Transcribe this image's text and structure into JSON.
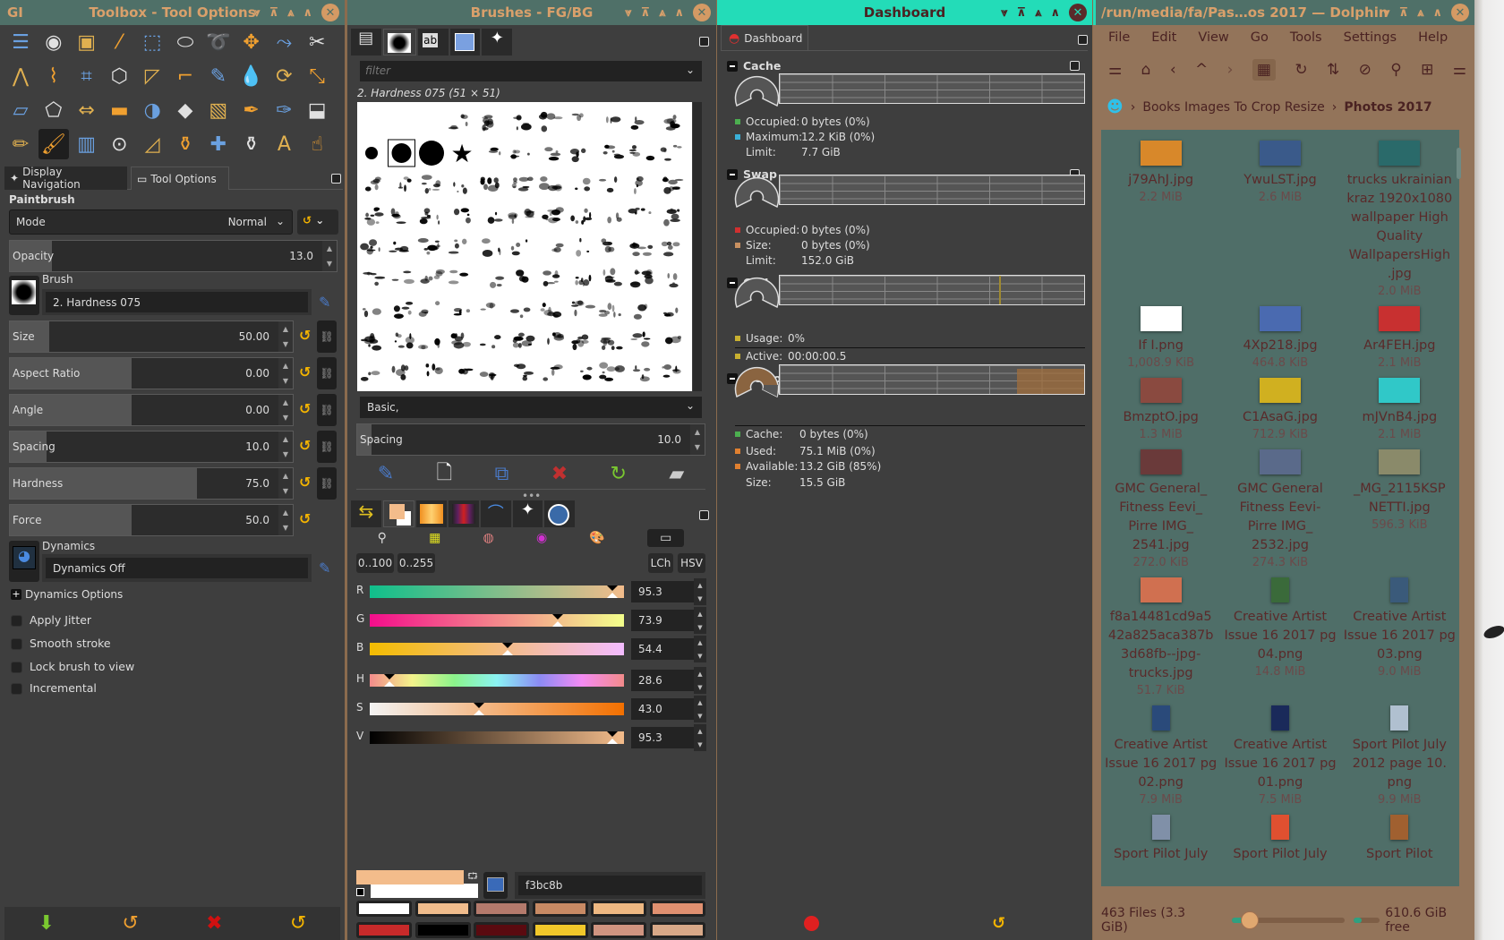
{
  "toolbox": {
    "app_icon": "GI",
    "title": "Toolbox - Tool Options",
    "tools": [
      "align-icon",
      "fg-select-icon",
      "foreground-select-icon",
      "fuzzy-select-icon",
      "rect-select-icon",
      "ellipse-select-icon",
      "free-select-icon",
      "move-icon",
      "paths-icon",
      "scissors-icon",
      "measure-icon",
      "warp-icon",
      "cage-icon",
      "perspective-icon",
      "unified-transform-icon",
      "crop-icon",
      "color-picker-icon",
      "blur-icon",
      "rotate-icon",
      "scale-icon",
      "shear-icon",
      "handle-transform-icon",
      "flip-icon",
      "eraser-icon",
      "dodge-burn-icon",
      "smudge-icon",
      "mypaint-icon",
      "ink-icon",
      "airbrush-icon",
      "bucket-fill-icon",
      "pencil-icon",
      "paintbrush-icon",
      "levels-icon",
      "magnify-icon",
      "curves-icon",
      "clone-icon",
      "heal-icon",
      "perspective-clone-icon",
      "text-icon",
      "smudge-hand-icon"
    ],
    "tabs": [
      "Display Navigation",
      "Tool Options"
    ],
    "tool_name": "Paintbrush",
    "mode_label": "Mode",
    "mode_value": "Normal",
    "opacity": {
      "label": "Opacity",
      "value": "13.0",
      "fraction": 0.13
    },
    "brush_label": "Brush",
    "brush_value": "2. Hardness 075",
    "params": [
      {
        "label": "Size",
        "value": "50.00",
        "fraction": 0.14
      },
      {
        "label": "Aspect Ratio",
        "value": "0.00",
        "fraction": 0.43
      },
      {
        "label": "Angle",
        "value": "0.00",
        "fraction": 0.43
      },
      {
        "label": "Spacing",
        "value": "10.0",
        "fraction": 0.13
      },
      {
        "label": "Hardness",
        "value": "75.0",
        "fraction": 0.66
      },
      {
        "label": "Force",
        "value": "50.0",
        "fraction": 0.43
      }
    ],
    "dynamics_label": "Dynamics",
    "dynamics_value": "Dynamics Off",
    "dynamics_options": "Dynamics Options",
    "checkboxes": [
      "Apply Jitter",
      "Smooth stroke",
      "Lock brush to view",
      "Incremental"
    ]
  },
  "brushes": {
    "title": "Brushes - FG/BG",
    "filter_placeholder": "filter",
    "selected": "2. Hardness 075 (51 × 51)",
    "tag": "Basic,",
    "spacing_label": "Spacing",
    "spacing_value": "10.0",
    "range_buttons": [
      "0..100",
      "0..255"
    ],
    "model_buttons": [
      "LCh",
      "HSV"
    ],
    "sliders": [
      {
        "label": "R",
        "value": "95.3",
        "fraction": 0.953,
        "grad": "linear-gradient(90deg,#0fbf8b,#f3bc8b)"
      },
      {
        "label": "G",
        "value": "73.9",
        "fraction": 0.739,
        "grad": "linear-gradient(90deg,#f30d8b,#f3ff8b)"
      },
      {
        "label": "B",
        "value": "54.4",
        "fraction": 0.544,
        "grad": "linear-gradient(90deg,#f3bc00,#f3bcff)"
      },
      {
        "label": "H",
        "value": "28.6",
        "fraction": 0.079,
        "grad": "linear-gradient(90deg,#f38b8b,#f3f38b,#8bf38b,#8bf3f3,#8b8bf3,#f38bf3,#f38b8b)"
      },
      {
        "label": "S",
        "value": "43.0",
        "fraction": 0.43,
        "grad": "linear-gradient(90deg,#f3f3f3,#f37000)"
      },
      {
        "label": "V",
        "value": "95.3",
        "fraction": 0.953,
        "grad": "linear-gradient(90deg,#000,#f3bc8b)"
      }
    ],
    "hex": "f3bc8b",
    "fg": "#f3bc8b",
    "bg": "#ffffff",
    "swatches": [
      "#ffffff",
      "#f0bc8c",
      "#b47a6c",
      "#c88a64",
      "#eeb882",
      "#e09070",
      "#c82a2a",
      "#000000",
      "#5a0a10",
      "#f2c82a",
      "#d09480",
      "#d8a888"
    ]
  },
  "dashboard": {
    "title": "Dashboard",
    "tab": "Dashboard",
    "cache": {
      "title": "Cache",
      "rows": [
        [
          "Occupied:",
          "0 bytes (0%)",
          "#4caf50"
        ],
        [
          "Maximum:",
          "12.2 KiB (0%)",
          "#3ab0d8"
        ],
        [
          "Limit:",
          "7.7 GiB",
          ""
        ]
      ]
    },
    "swap": {
      "title": "Swap",
      "rows": [
        [
          "Occupied:",
          "0 bytes (0%)",
          "#d03030"
        ],
        [
          "Size:",
          "0 bytes (0%)",
          "#c89060"
        ],
        [
          "Limit:",
          "152.0 GiB",
          ""
        ]
      ]
    },
    "cpu": {
      "title": "CPU",
      "rows": [
        [
          "Usage:",
          "0%",
          "#c8b030"
        ],
        [
          "Active:",
          "00:00:00.5",
          "#c8b030"
        ]
      ]
    },
    "memory": {
      "title": "Memory",
      "used_fraction": 0.15,
      "rows": [
        [
          "Cache:",
          "0 bytes (0%)",
          "#4caf50"
        ],
        [
          "Used:",
          "75.1 MiB (0%)",
          "#e08030"
        ],
        [
          "Available:",
          "13.2 GiB (85%)",
          "#e08030"
        ],
        [
          "Size:",
          "15.5 GiB",
          ""
        ]
      ]
    }
  },
  "dolphin": {
    "title": "/run/media/fa/Pas…os 2017 — Dolphin",
    "menu": [
      "File",
      "Edit",
      "View",
      "Go",
      "Tools",
      "Settings",
      "Help"
    ],
    "breadcrumb": [
      "Books Images To Crop Resize",
      "Photos 2017"
    ],
    "files": [
      {
        "name": "j79AhJ.jpg",
        "size": "2.2 MiB",
        "thumb": "#d8882a"
      },
      {
        "name": "YwuLST.jpg",
        "size": "2.6 MiB",
        "thumb": "#3a5a8a"
      },
      {
        "name": "trucks ukrainian kraz 1920x1080 wallpaper High Quality WallpapersHigh .jpg",
        "size": "2.0 MiB",
        "thumb": "#2a6a6a"
      },
      {
        "name": "If I.png",
        "size": "1,008.9 KiB",
        "thumb": "#ffffff"
      },
      {
        "name": "4Xp218.jpg",
        "size": "464.8 KiB",
        "thumb": "#4a6ab0"
      },
      {
        "name": "Ar4FEH.jpg",
        "size": "2.1 MiB",
        "thumb": "#c83030"
      },
      {
        "name": "BmzptO.jpg",
        "size": "1.3 MiB",
        "thumb": "#8a4a40"
      },
      {
        "name": "C1AsaG.jpg",
        "size": "712.9 KiB",
        "thumb": "#d0b020"
      },
      {
        "name": "mJVnB4.jpg",
        "size": "2.1 MiB",
        "thumb": "#30c8c8"
      },
      {
        "name": "GMC General_ Fitness Eevi_ Pirre IMG_ 2541.jpg",
        "size": "272.0 KiB",
        "thumb": "#6a3a3a"
      },
      {
        "name": "GMC General Fitness Eevi- Pirre IMG_ 2532.jpg",
        "size": "274.3 KiB",
        "thumb": "#5a6a8a"
      },
      {
        "name": "_MG_2115KSP NETTI.jpg",
        "size": "596.3 KiB",
        "thumb": "#8a8a6a"
      },
      {
        "name": "f8a14481cd9a5 42a825aca387b 3d68fb--jpg- trucks.jpg",
        "size": "51.7 KiB",
        "thumb": "#d07050"
      },
      {
        "name": "Creative Artist Issue 16 2017 pg 04.png",
        "size": "14.8 MiB",
        "thumb": "#3a6a3a"
      },
      {
        "name": "Creative Artist Issue 16 2017 pg 03.png",
        "size": "9.0 MiB",
        "thumb": "#3a5a7a"
      },
      {
        "name": "Creative Artist Issue 16 2017 pg 02.png",
        "size": "7.9 MiB",
        "thumb": "#2a4a7a"
      },
      {
        "name": "Creative Artist Issue 16 2017 pg 01.png",
        "size": "7.5 MiB",
        "thumb": "#1a2a5a"
      },
      {
        "name": "Sport Pilot July 2012 page 10. png",
        "size": "9.9 MiB",
        "thumb": "#b0c0d0"
      },
      {
        "name": "Sport Pilot July",
        "size": "",
        "thumb": "#8090a8"
      },
      {
        "name": "Sport Pilot July",
        "size": "",
        "thumb": "#e05030"
      },
      {
        "name": "Sport Pilot",
        "size": "",
        "thumb": "#a06030"
      }
    ],
    "status": "463 Files (3.3 GiB)",
    "zoom_fraction": 0.12,
    "free": "610.6 GiB free",
    "free_fraction": 0.3
  }
}
